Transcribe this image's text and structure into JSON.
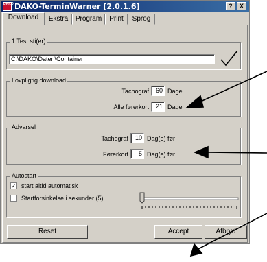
{
  "window": {
    "title": "DAKO-TerminWarner [2.0.1.6]",
    "icon_text": "DAKO",
    "help_btn": "?",
    "close_btn": "X"
  },
  "tabs": [
    "Download",
    "Ekstra",
    "Program",
    "Print",
    "Sprog"
  ],
  "test_path": {
    "legend": "1 Test sti(er)",
    "value": "C:\\DAKO\\Daten\\Container"
  },
  "download": {
    "legend": "Lovpligtig download",
    "rows": [
      {
        "label": "Tachograf",
        "value": "60",
        "unit": "Dage"
      },
      {
        "label": "Alle førerkort",
        "value": "21",
        "unit": "Dage"
      }
    ]
  },
  "warning": {
    "legend": "Advarsel",
    "rows": [
      {
        "label": "Tachograf",
        "value": "10",
        "unit": "Dag(e) før"
      },
      {
        "label": "Førerkort",
        "value": "5",
        "unit": "Dag(e) før"
      }
    ]
  },
  "autostart": {
    "legend": "Autostart",
    "auto_label": "start altid automatisk",
    "auto_checked": true,
    "delay_label": "Startforsinkelse i sekunder (5)",
    "delay_checked": false
  },
  "buttons": {
    "reset": "Reset",
    "accept": "Accept",
    "cancel": "Afbryd"
  }
}
